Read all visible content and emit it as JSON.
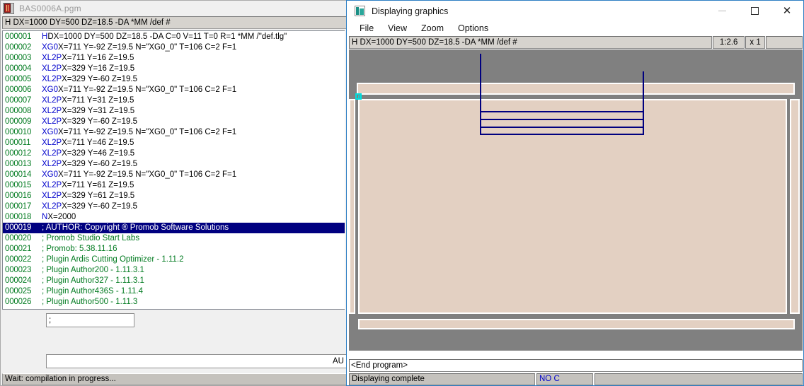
{
  "editor": {
    "title": "BAS0006A.pgm",
    "icon": "book-icon",
    "header_field": "H DX=1000 DY=500 DZ=18.5 -DA *MM /def #",
    "command_input_value": ";",
    "long_input_value": "AU",
    "status": "Wait: compilation in progress...",
    "selected_line": 19,
    "lines": [
      {
        "num": "000001",
        "kw": "H",
        "text": " DX=1000 DY=500 DZ=18.5 -DA C=0 V=11 T=0 R=1 *MM /\"def.tlg\"",
        "type": "code"
      },
      {
        "num": "000002",
        "kw": "XG0",
        "text": " X=711 Y=-92 Z=19.5 N=\"XG0_0\" T=106 C=2 F=1",
        "type": "code"
      },
      {
        "num": "000003",
        "kw": "XL2P",
        "text": " X=711 Y=16 Z=19.5",
        "type": "code"
      },
      {
        "num": "000004",
        "kw": "XL2P",
        "text": " X=329 Y=16 Z=19.5",
        "type": "code"
      },
      {
        "num": "000005",
        "kw": "XL2P",
        "text": " X=329 Y=-60 Z=19.5",
        "type": "code"
      },
      {
        "num": "000006",
        "kw": "XG0",
        "text": " X=711 Y=-92 Z=19.5 N=\"XG0_0\" T=106 C=2 F=1",
        "type": "code"
      },
      {
        "num": "000007",
        "kw": "XL2P",
        "text": " X=711 Y=31 Z=19.5",
        "type": "code"
      },
      {
        "num": "000008",
        "kw": "XL2P",
        "text": " X=329 Y=31 Z=19.5",
        "type": "code"
      },
      {
        "num": "000009",
        "kw": "XL2P",
        "text": " X=329 Y=-60 Z=19.5",
        "type": "code"
      },
      {
        "num": "000010",
        "kw": "XG0",
        "text": " X=711 Y=-92 Z=19.5 N=\"XG0_0\" T=106 C=2 F=1",
        "type": "code"
      },
      {
        "num": "000011",
        "kw": "XL2P",
        "text": " X=711 Y=46 Z=19.5",
        "type": "code"
      },
      {
        "num": "000012",
        "kw": "XL2P",
        "text": " X=329 Y=46 Z=19.5",
        "type": "code"
      },
      {
        "num": "000013",
        "kw": "XL2P",
        "text": " X=329 Y=-60 Z=19.5",
        "type": "code"
      },
      {
        "num": "000014",
        "kw": "XG0",
        "text": " X=711 Y=-92 Z=19.5 N=\"XG0_0\" T=106 C=2 F=1",
        "type": "code"
      },
      {
        "num": "000015",
        "kw": "XL2P",
        "text": " X=711 Y=61 Z=19.5",
        "type": "code"
      },
      {
        "num": "000016",
        "kw": "XL2P",
        "text": " X=329 Y=61 Z=19.5",
        "type": "code"
      },
      {
        "num": "000017",
        "kw": "XL2P",
        "text": " X=329 Y=-60 Z=19.5",
        "type": "code"
      },
      {
        "num": "000018",
        "kw": "N",
        "text": " X=2000",
        "type": "code"
      },
      {
        "num": "000019",
        "kw": "",
        "text": "; AUTHOR: Copyright ® Promob Software Solutions",
        "type": "comment",
        "selected": true
      },
      {
        "num": "000020",
        "kw": "",
        "text": "; Promob Studio Start Labs",
        "type": "comment"
      },
      {
        "num": "000021",
        "kw": "",
        "text": "; Promob: 5.38.11.16",
        "type": "comment"
      },
      {
        "num": "000022",
        "kw": "",
        "text": "; Plugin Ardis Cutting Optimizer - 1.11.2",
        "type": "comment"
      },
      {
        "num": "000023",
        "kw": "",
        "text": "; Plugin Author200 - 1.11.3.1",
        "type": "comment"
      },
      {
        "num": "000024",
        "kw": "",
        "text": "; Plugin Author327 - 1.11.3.1",
        "type": "comment"
      },
      {
        "num": "000025",
        "kw": "",
        "text": "; Plugin Author436S - 1.11.4",
        "type": "comment"
      },
      {
        "num": "000026",
        "kw": "",
        "text": "; Plugin Author500 - 1.11.3",
        "type": "comment"
      }
    ]
  },
  "graphics": {
    "title": "Displaying graphics",
    "icon": "graphics-icon",
    "window_controls": {
      "minimize": "—",
      "maximize": "□",
      "close": "✕"
    },
    "menu": [
      "File",
      "View",
      "Zoom",
      "Options"
    ],
    "info": {
      "header": "H DX=1000 DY=500 DZ=18.5 -DA *MM /def #",
      "scale": "1:2.6",
      "multiplier": "x 1",
      "extra": ""
    },
    "end_text": "<End program>",
    "status": {
      "message": "Displaying complete",
      "noc": "NO C",
      "extra": ""
    },
    "colors": {
      "background": "#808080",
      "workpiece": "#e3d0c2",
      "toolpath": "#00007f",
      "origin_marker": "#00dede",
      "accent": "#2f7fc4"
    }
  }
}
